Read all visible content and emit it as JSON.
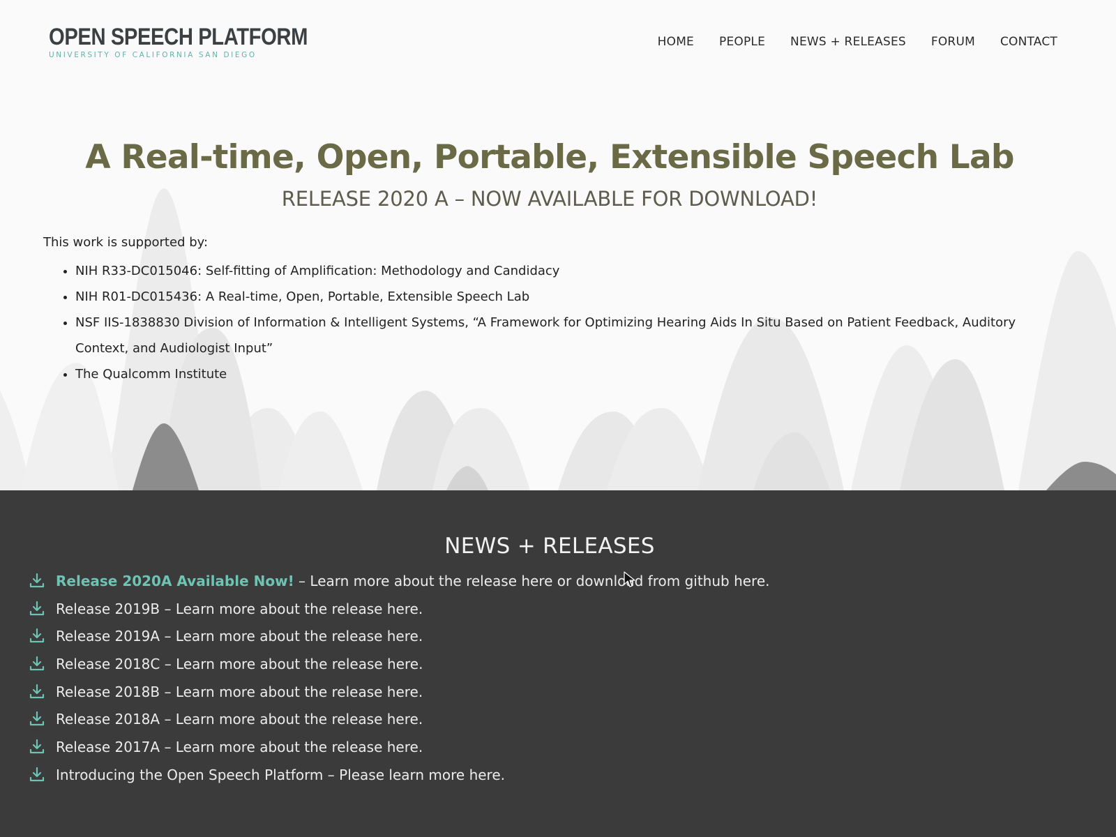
{
  "header": {
    "logo_title": "OPEN SPEECH PLATFORM",
    "logo_subtitle": "UNIVERSITY OF CALIFORNIA SAN DIEGO",
    "nav": [
      "HOME",
      "PEOPLE",
      "NEWS + RELEASES",
      "FORUM",
      "CONTACT"
    ]
  },
  "hero": {
    "title": "A Real-time, Open, Portable, Extensible Speech Lab",
    "subtitle": "RELEASE 2020 A – NOW AVAILABLE FOR DOWNLOAD!",
    "support_intro": "This work is supported by:",
    "support_items": [
      "NIH R33-DC015046: Self-fitting of Amplification: Methodology and Candidacy",
      "NIH R01-DC015436: A Real-time, Open, Portable, Extensible Speech Lab",
      "NSF IIS-1838830 Division of Information & Intelligent Systems, “A Framework for Optimizing Hearing Aids In Situ Based on Patient Feedback, Auditory Context, and Audiologist Input”",
      "The Qualcomm Institute"
    ]
  },
  "news": {
    "title": "NEWS + RELEASES",
    "items": [
      {
        "highlight": "Release 2020A Available Now!",
        "text": " – Learn more about the release here or download from github here."
      },
      {
        "highlight": "",
        "text": "Release 2019B – Learn more about the release here."
      },
      {
        "highlight": "",
        "text": "Release 2019A – Learn more about the release here."
      },
      {
        "highlight": "",
        "text": "Release 2018C – Learn more about the release here."
      },
      {
        "highlight": "",
        "text": "Release 2018B – Learn more about the release here."
      },
      {
        "highlight": "",
        "text": "Release 2018A – Learn more about the release here."
      },
      {
        "highlight": "",
        "text": "Release 2017A – Learn more about the release here."
      },
      {
        "highlight": "",
        "text": "Introducing the Open Speech Platform – Please learn more here."
      }
    ]
  },
  "colors": {
    "accent": "#6ec4b4",
    "title_olive": "#6b6a47",
    "dark_band": "#3b3b3b"
  },
  "icons": [
    "download-icon",
    "mouse-cursor-icon"
  ]
}
